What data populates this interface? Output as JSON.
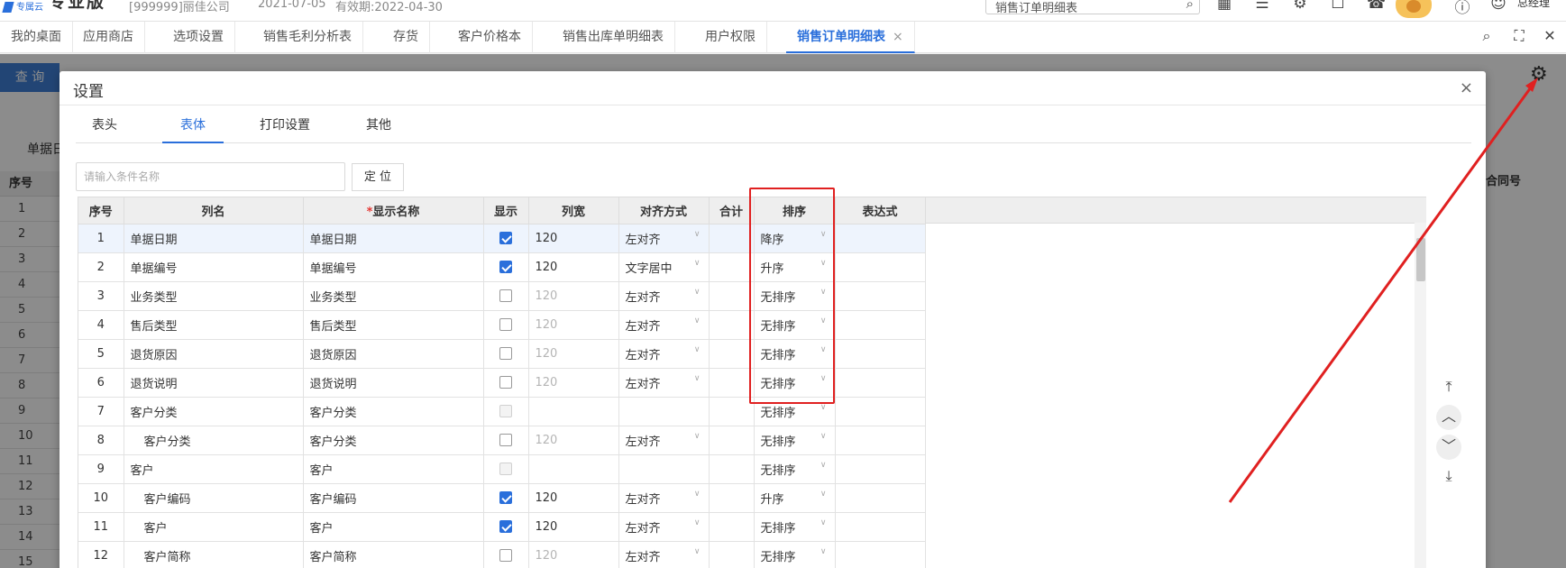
{
  "header": {
    "logo_small": "专属云",
    "logo_big": "专业版",
    "company": "[999999]丽佳公司",
    "date": "2021-07-05",
    "expire": "有效期:2022-04-30",
    "search_value": "销售订单明细表",
    "user_name": "总经理"
  },
  "tabs": [
    {
      "label": "我的桌面"
    },
    {
      "label": "应用商店"
    },
    {
      "label": "选项设置"
    },
    {
      "label": "销售毛利分析表"
    },
    {
      "label": "存货"
    },
    {
      "label": "客户价格本"
    },
    {
      "label": "销售出库单明细表"
    },
    {
      "label": "用户权限"
    },
    {
      "label": "销售订单明细表",
      "active": true,
      "close": "×"
    }
  ],
  "page": {
    "query_button": "查 询",
    "date_label": "单据日",
    "seq_header": "序号",
    "right_header": "合同号",
    "row_numbers": [
      "1",
      "2",
      "3",
      "4",
      "5",
      "6",
      "7",
      "8",
      "9",
      "10",
      "11",
      "12",
      "13",
      "14",
      "15"
    ]
  },
  "modal": {
    "title": "设置",
    "close": "×",
    "tabs": [
      "表头",
      "表体",
      "打印设置",
      "其他"
    ],
    "active_tab": "表体",
    "search_placeholder": "请输入条件名称",
    "locate_button": "定 位",
    "columns": {
      "seq": "序号",
      "name": "列名",
      "required_mark": "*",
      "display_name": "显示名称",
      "show": "显示",
      "width": "列宽",
      "align": "对齐方式",
      "total": "合计",
      "sort": "排序",
      "expr": "表达式"
    },
    "rows": [
      {
        "seq": "1",
        "name": "单据日期",
        "display": "单据日期",
        "show": "on",
        "width": "120",
        "width_dim": false,
        "align": "左对齐",
        "sort": "降序",
        "indent": false
      },
      {
        "seq": "2",
        "name": "单据编号",
        "display": "单据编号",
        "show": "on",
        "width": "120",
        "width_dim": false,
        "align": "文字居中",
        "sort": "升序",
        "indent": false
      },
      {
        "seq": "3",
        "name": "业务类型",
        "display": "业务类型",
        "show": "off",
        "width": "120",
        "width_dim": true,
        "align": "左对齐",
        "sort": "无排序",
        "indent": false
      },
      {
        "seq": "4",
        "name": "售后类型",
        "display": "售后类型",
        "show": "off",
        "width": "120",
        "width_dim": true,
        "align": "左对齐",
        "sort": "无排序",
        "indent": false
      },
      {
        "seq": "5",
        "name": "退货原因",
        "display": "退货原因",
        "show": "off",
        "width": "120",
        "width_dim": true,
        "align": "左对齐",
        "sort": "无排序",
        "indent": false
      },
      {
        "seq": "6",
        "name": "退货说明",
        "display": "退货说明",
        "show": "off",
        "width": "120",
        "width_dim": true,
        "align": "左对齐",
        "sort": "无排序",
        "indent": false
      },
      {
        "seq": "7",
        "name": "客户分类",
        "display": "客户分类",
        "show": "disabled",
        "width": "",
        "width_dim": false,
        "align": "",
        "sort": "无排序",
        "indent": false
      },
      {
        "seq": "8",
        "name": "客户分类",
        "display": "客户分类",
        "show": "off",
        "width": "120",
        "width_dim": true,
        "align": "左对齐",
        "sort": "无排序",
        "indent": true
      },
      {
        "seq": "9",
        "name": "客户",
        "display": "客户",
        "show": "disabled",
        "width": "",
        "width_dim": false,
        "align": "",
        "sort": "无排序",
        "indent": false
      },
      {
        "seq": "10",
        "name": "客户编码",
        "display": "客户编码",
        "show": "on",
        "width": "120",
        "width_dim": false,
        "align": "左对齐",
        "sort": "升序",
        "indent": true
      },
      {
        "seq": "11",
        "name": "客户",
        "display": "客户",
        "show": "on",
        "width": "120",
        "width_dim": false,
        "align": "左对齐",
        "sort": "无排序",
        "indent": true
      },
      {
        "seq": "12",
        "name": "客户简称",
        "display": "客户简称",
        "show": "off",
        "width": "120",
        "width_dim": true,
        "align": "左对齐",
        "sort": "无排序",
        "indent": true
      }
    ],
    "sort_controls": [
      "⤒",
      "︿",
      "﹀",
      "⤓"
    ]
  },
  "colors": {
    "accent": "#2a6fdb",
    "highlight_box": "#e02020",
    "arrow": "#e02020"
  },
  "icons": [
    "search-icon",
    "building-icon",
    "tasks-icon",
    "settings-cube-icon",
    "bell-icon",
    "phone-icon",
    "help-icon",
    "user-icon",
    "fullscreen-icon",
    "close-icon",
    "gear-icon"
  ]
}
